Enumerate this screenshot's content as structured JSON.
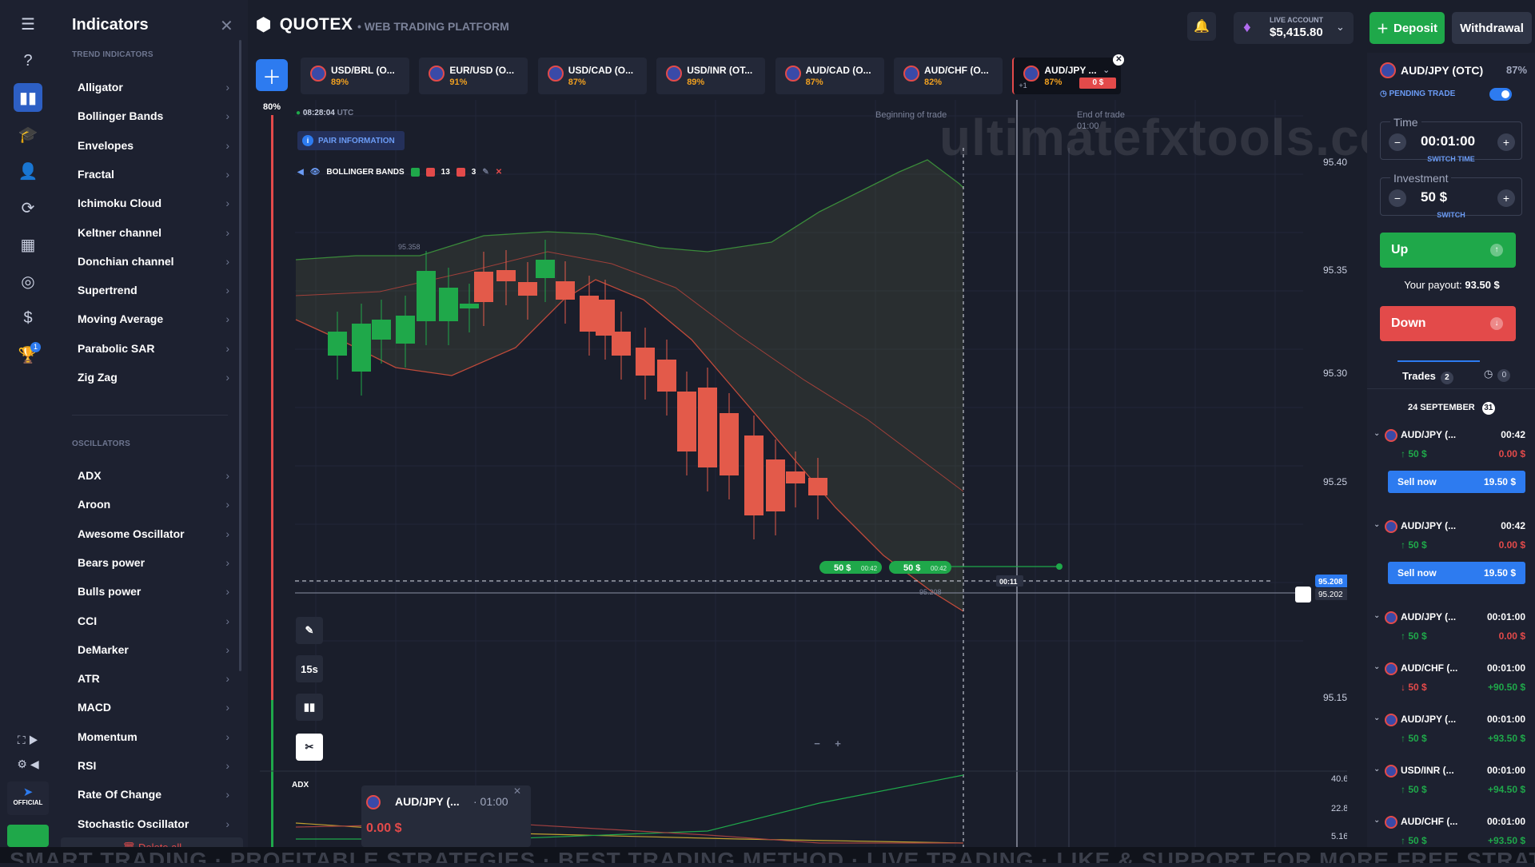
{
  "sidebar": {
    "icons": [
      "menu-icon",
      "help-icon",
      "chart-icon",
      "education-icon",
      "user-icon",
      "refresh-icon",
      "market-icon",
      "signal-icon",
      "coins-icon",
      "trophy-icon"
    ],
    "trophy_badge": "1",
    "official_label": "OFFICIAL"
  },
  "indicators": {
    "title": "Indicators",
    "trend_title": "TREND INDICATORS",
    "trend": [
      "Alligator",
      "Bollinger Bands",
      "Envelopes",
      "Fractal",
      "Ichimoku Cloud",
      "Keltner channel",
      "Donchian channel",
      "Supertrend",
      "Moving Average",
      "Parabolic SAR",
      "Zig Zag"
    ],
    "osc_title": "OSCILLATORS",
    "oscillators": [
      "ADX",
      "Aroon",
      "Awesome Oscillator",
      "Bears power",
      "Bulls power",
      "CCI",
      "DeMarker",
      "ATR",
      "MACD",
      "Momentum",
      "RSI",
      "Rate Of Change",
      "Stochastic Oscillator"
    ],
    "delete_all": "Delete all"
  },
  "header": {
    "brand": "QUOTEX",
    "subtitle": "WEB TRADING PLATFORM",
    "account_label": "LIVE ACCOUNT",
    "balance": "$5,415.80",
    "deposit": "Deposit",
    "withdrawal": "Withdrawal"
  },
  "asset_tabs": [
    {
      "name": "USD/BRL (O...",
      "pct": "89%"
    },
    {
      "name": "EUR/USD (O...",
      "pct": "91%"
    },
    {
      "name": "USD/CAD (O...",
      "pct": "87%"
    },
    {
      "name": "USD/INR (OT...",
      "pct": "89%"
    },
    {
      "name": "AUD/CAD (O...",
      "pct": "87%"
    },
    {
      "name": "AUD/CHF (O...",
      "pct": "82%"
    },
    {
      "name": "AUD/JPY ...",
      "pct": "87%",
      "badge": "0 $",
      "extra": "+1"
    }
  ],
  "chart": {
    "payout_pct": "80%",
    "time": "08:28:04",
    "tz": "UTC",
    "pair_info": "PAIR INFORMATION",
    "bb_label": "BOLLINGER BANDS",
    "bb_period": "13",
    "bb_dev": "3",
    "beginning": "Beginning of trade",
    "end": "End of trade",
    "end_time": "01:00",
    "prices": [
      "95.400",
      "95.350",
      "95.300",
      "95.250",
      "95.150"
    ],
    "current_price": "95.208",
    "line_price": "95.202",
    "high_label": "95.358",
    "chart_price_label": "95.208",
    "countdown": "00:11",
    "marker1": "50 $",
    "marker1_time": "00:42",
    "marker2": "50 $",
    "marker2_time": "00:42",
    "timeframe": "15s",
    "adx_label": "ADX",
    "adx_axis": [
      "40.62",
      "22.89",
      "5.16"
    ],
    "watermark": "ultimatefxtools.com"
  },
  "adx_popup": {
    "pair": "AUD/JPY (...",
    "time": "· 01:00",
    "amount": "0.00 $"
  },
  "right_panel": {
    "asset": "AUD/JPY (OTC)",
    "pct": "87%",
    "pending": "PENDING TRADE",
    "time_label": "Time",
    "time_value": "00:01:00",
    "switch_time": "SWITCH TIME",
    "investment_label": "Investment",
    "investment_value": "50 $",
    "switch": "SWITCH",
    "up": "Up",
    "payout_label": "Your payout:",
    "payout_value": "93.50 $",
    "down": "Down",
    "trades_label": "Trades",
    "trades_count": "2",
    "history_count": "0",
    "date": "24 SEPTEMBER",
    "date_badge": "31",
    "trades": [
      {
        "name": "AUD/JPY (...",
        "time": "00:42",
        "amount": "50 $",
        "pl": "0.00 $",
        "sell": "Sell now",
        "sell_val": "19.50 $",
        "pl_color": "#e34a4a"
      },
      {
        "name": "AUD/JPY (...",
        "time": "00:42",
        "amount": "50 $",
        "pl": "0.00 $",
        "sell": "Sell now",
        "sell_val": "19.50 $",
        "pl_color": "#e34a4a"
      },
      {
        "name": "AUD/JPY (...",
        "time": "00:01:00",
        "amount": "50 $",
        "pl": "0.00 $",
        "pl_color": "#e34a4a"
      },
      {
        "name": "AUD/CHF (...",
        "time": "00:01:00",
        "amount": "50 $",
        "pl": "+90.50 $",
        "pl_color": "#1fa84a",
        "down": true
      },
      {
        "name": "AUD/JPY (...",
        "time": "00:01:00",
        "amount": "50 $",
        "pl": "+93.50 $",
        "pl_color": "#1fa84a"
      },
      {
        "name": "USD/INR (...",
        "time": "00:01:00",
        "amount": "50 $",
        "pl": "+94.50 $",
        "pl_color": "#1fa84a"
      },
      {
        "name": "AUD/CHF (...",
        "time": "00:01:00",
        "amount": "50 $",
        "pl": "+93.50 $",
        "pl_color": "#1fa84a"
      }
    ]
  },
  "ticker": "SMART TRADING · PROFITABLE STRATEGIES · BEST TRADING METHOD · LIVE TRADING · LIKE & SUPPORT FOR MORE FREE STRATEGIES"
}
